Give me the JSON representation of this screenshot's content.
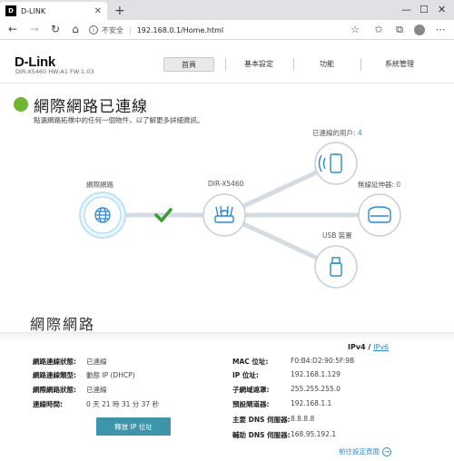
{
  "browser": {
    "tab_title": "D-LINK",
    "favicon_text": "D",
    "new_tab": "+",
    "security_label": "不安全",
    "url": "192.168.0.1/Home.html"
  },
  "header": {
    "logo": "D-Link",
    "model_line": "DIR-X5460  HW:A1  FW:1.03",
    "menu": [
      "首頁",
      "基本設定",
      "功能",
      "系統管理"
    ]
  },
  "status": {
    "title": "網際網路已連線",
    "subtitle": "點選網路拓樸中的任何一個物件，以了解更多詳細資訊。",
    "color": "#72b52f"
  },
  "topology": {
    "internet_label": "網際網路",
    "router_label": "DIR-X5460",
    "clients_label": "已連線的用戶:",
    "clients_count": "4",
    "extender_label": "無線延伸器:",
    "extender_count": "0",
    "usb_label": "USB 裝置",
    "accent": "#2a8ad4"
  },
  "internet": {
    "section_title": "網際網路",
    "ipv4_tab": "IPv4",
    "tab_sep": "/",
    "ipv6_tab": "IPv6",
    "left": [
      {
        "label": "網路連線狀態:",
        "value": "已連線"
      },
      {
        "label": "網路連線類型:",
        "value": "動態 IP (DHCP)"
      },
      {
        "label": "網際網路狀態:",
        "value": "已連線"
      },
      {
        "label": "連線時間:",
        "value": "0 天 21 時 31 分 37 秒"
      }
    ],
    "right": [
      {
        "label": "MAC 位址:",
        "value": "F0:B4:D2:90:5F:9B"
      },
      {
        "label": "IP 位址:",
        "value": "192.168.1.129"
      },
      {
        "label": "子網域遮罩:",
        "value": "255.255.255.0"
      },
      {
        "label": "預設閘道器:",
        "value": "192.168.1.1"
      },
      {
        "label": "主要 DNS 伺服器:",
        "value": "8.8.8.8"
      },
      {
        "label": "輔助 DNS 伺服器:",
        "value": "168.95.192.1"
      }
    ],
    "release_button": "釋放 IP 位址",
    "advanced_link": "前往設定頁面"
  }
}
